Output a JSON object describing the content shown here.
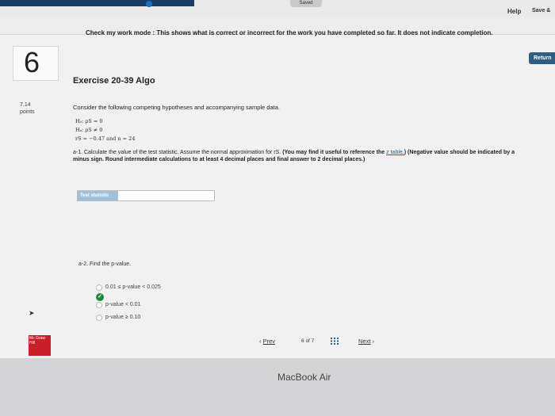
{
  "topbar": {
    "saved_label": "Saved",
    "help_label": "Help",
    "save_exit_label": "Save &"
  },
  "checkbar": {
    "message": "Check my work mode : This shows what is correct or incorrect for the work you have completed so far. It does not indicate completion."
  },
  "return_label": "Return",
  "question_number": "6",
  "exercise_title": "Exercise 20-39 Algo",
  "points": {
    "value": "7.14",
    "label": "points"
  },
  "question": {
    "intro": "Consider the following competing hypotheses and accompanying sample data.",
    "h0": "H₀: ρS = 0",
    "ha": "Hₐ: ρS ≠ 0",
    "data": "rS = −0.47 and n = 24"
  },
  "part_a1": {
    "text": "a-1. Calculate the value of the test statistic. Assume the normal approximation for rS.",
    "bold_note_1": "(You may find it useful to reference the",
    "link": "z table.",
    "bold_note_2": ") (Negative value should be indicated by a minus sign. Round intermediate calculations to at least 4 decimal places and final answer to 2 decimal places.)",
    "input_label": "Test statistic",
    "input_value": ""
  },
  "part_a2": {
    "text": "a-2. Find the p-value.",
    "options": [
      "0.01 ≤ p-value < 0.025",
      "p-value < 0.01",
      "p-value ≥ 0.10"
    ],
    "selected_index": 0
  },
  "pager": {
    "prev_label": "Prev",
    "current": "6",
    "of_label": "of",
    "total": "7",
    "next_label": "Next"
  },
  "logo_text": "Mc Graw Hill",
  "bezel_brand": "MacBook Air",
  "colors": {
    "navy": "#1d3c63",
    "return_btn": "#2f5d86",
    "correct": "#1f8a3b",
    "logo": "#c8202a"
  }
}
